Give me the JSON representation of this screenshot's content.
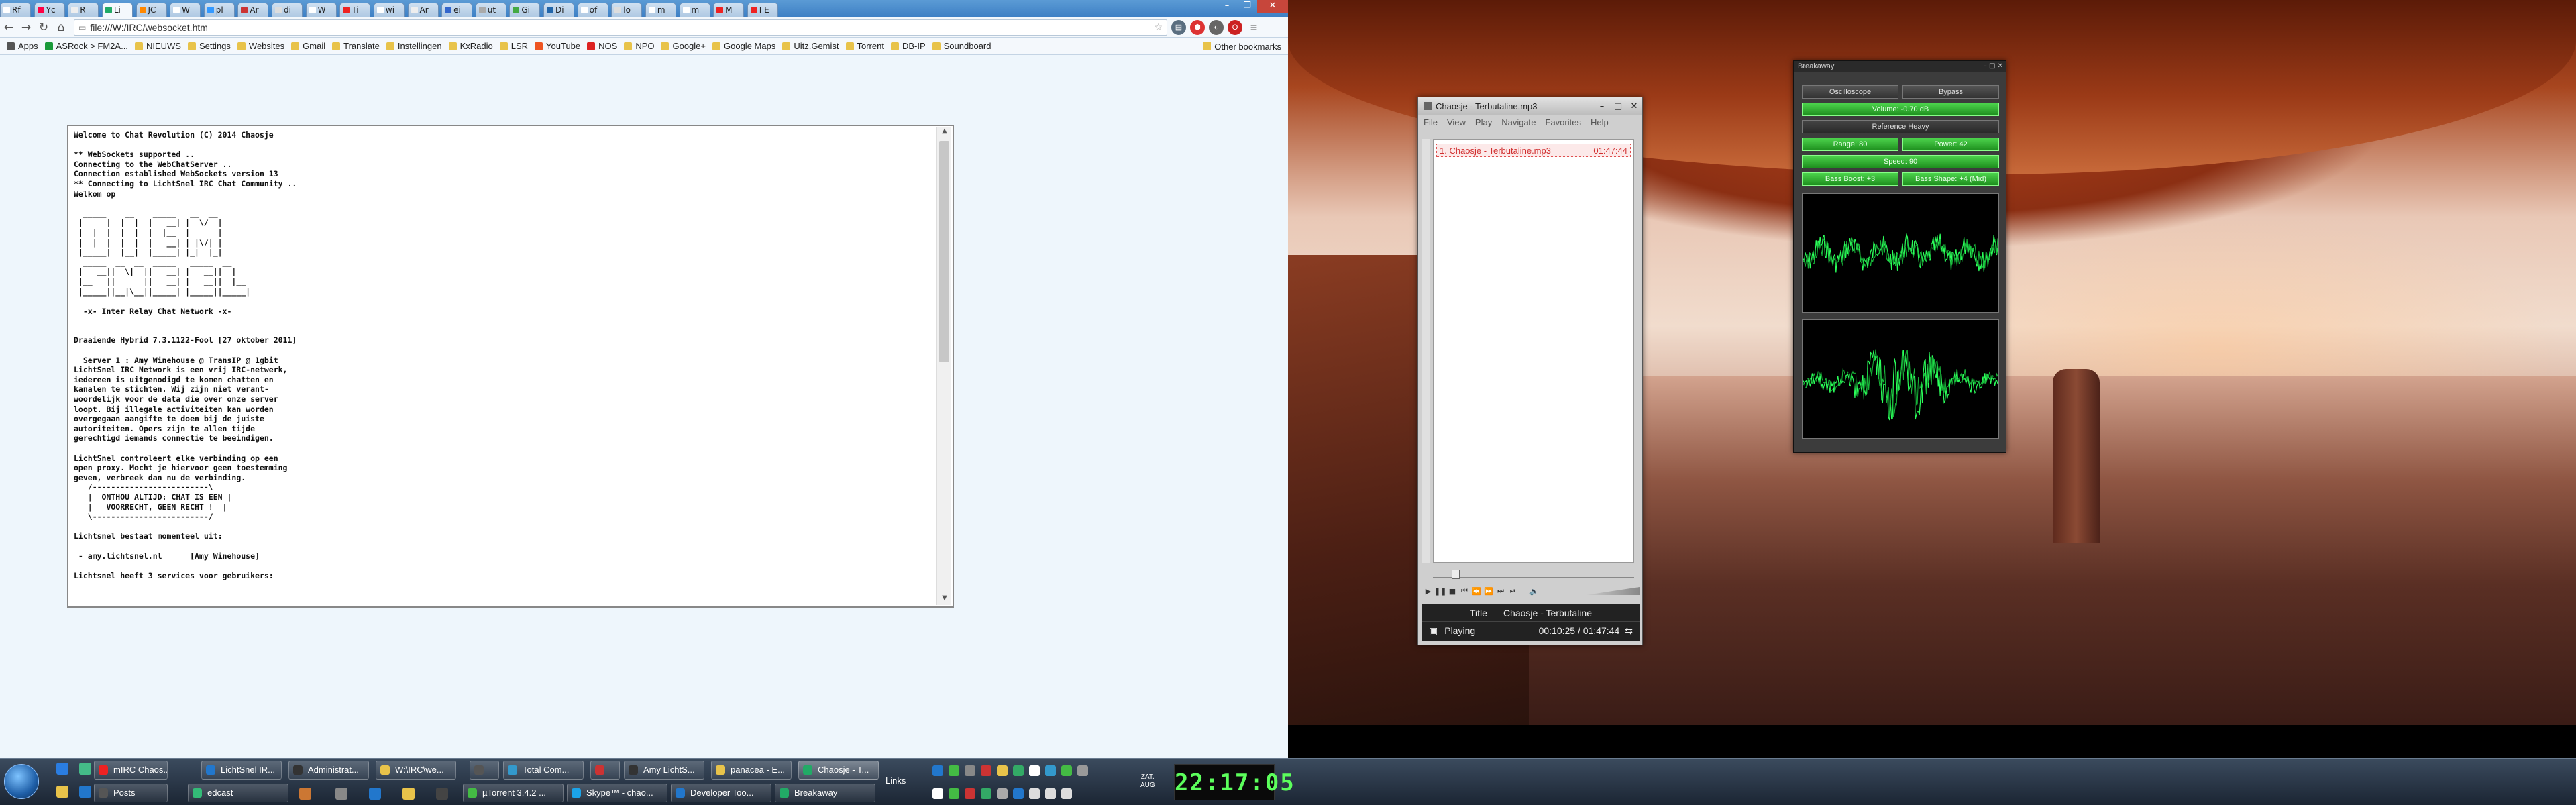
{
  "browser": {
    "tabs": [
      "Rf",
      "Yc",
      "R",
      "JC",
      "W",
      "pl",
      "Ar",
      "di",
      "W",
      "Ti",
      "wi",
      "Ar",
      "ei",
      "ut",
      "Gi",
      "Di",
      "of",
      "lo",
      "m",
      "m",
      "M",
      "I E"
    ],
    "active_tab_label": "Li",
    "url": "file:///W:/IRC/websocket.htm",
    "bookmarks": [
      "Apps",
      "ASRock > FM2A...",
      "NIEUWS",
      "Settings",
      "Websites",
      "Gmail",
      "Translate",
      "Instellingen",
      "KxRadio",
      "LSR",
      "YouTube",
      "NOS",
      "NPO",
      "Google+",
      "Google Maps",
      "Uitz.Gemist",
      "Torrent",
      "DB-IP",
      "Soundboard"
    ],
    "other_bookmarks": "Other bookmarks"
  },
  "chat": {
    "log": "Welcome to Chat Revolution (C) 2014 Chaosje\n\n** WebSockets supported ..\nConnecting to the WebChatServer ..\nConnection established WebSockets version 13\n** Connecting to LichtSnel IRC Chat Community ..\nWelkom op\n\n  _____    __    _____   __  __\n |     |  |  |  |   __| |  \\/  |\n |  |  |  |  |  |  |__  |      |\n |  |  |  |  |  |   __| | |\\/| |\n |_____|  |__|  |_____| |_|  |_|\n  _____  __  __  _____   _____  __\n |   __||  \\|  ||   __| |   __||  |\n |__   ||      ||   __| |   __||  |__\n |_____||__|\\__||_____| |_____||_____|\n\n  -x- Inter Relay Chat Network -x-\n\n\nDraaiende Hybrid 7.3.1122-Fool [27 oktober 2011]\n\n  Server 1 : Amy Winehouse @ TransIP @ 1gbit\nLichtSnel IRC Network is een vrij IRC-netwerk,\niedereen is uitgenodigd te komen chatten en\nkanalen te stichten. Wij zijn niet verant-\nwoordelijk voor de data die over onze server\nloopt. Bij illegale activiteiten kan worden\novergegaan aangifte te doen bij de juiste\nautoriteiten. Opers zijn te allen tijde\ngerechtigd iemands connectie te beeindigen.\n\nLichtSnel controleert elke verbinding op een\nopen proxy. Mocht je hiervoor geen toestemming\ngeven, verbreek dan nu de verbinding.\n   /-------------------------\\\n   |  ONTHOU ALTIJD: CHAT IS EEN |\n   |   VOORRECHT, GEEN RECHT !  |\n   \\-------------------------/\n\nLichtsnel bestaat momenteel uit:\n\n - amy.lichtsnel.nl      [Amy Winehouse]\n\nLichtsnel heeft 3 services voor gebruikers:"
  },
  "player": {
    "title": "Chaosje - Terbutaline.mp3",
    "menu": [
      "File",
      "View",
      "Play",
      "Navigate",
      "Favorites",
      "Help"
    ],
    "playlist": [
      {
        "name": "1. Chaosje - Terbutaline.mp3",
        "duration": "01:47:44"
      }
    ],
    "info_label": "Title",
    "info_value": "Chaosje - Terbutaline",
    "status": "Playing",
    "time": "00:10:25 / 01:47:44"
  },
  "breakaway": {
    "title": "Breakaway",
    "oscilloscope": "Oscilloscope",
    "bypass": "Bypass",
    "volume": "Volume: -0.70 dB",
    "preset": "Reference Heavy",
    "range": "Range: 80",
    "power": "Power: 42",
    "speed": "Speed: 90",
    "bass_boost": "Bass Boost: +3",
    "bass_shape": "Bass Shape: +4 (Mid)"
  },
  "taskbar": {
    "row1": [
      "mIRC Chaos...",
      "LichtSnel IR...",
      "Administrat...",
      "W:\\IRC\\we...",
      "",
      "Total Com...",
      "",
      "Amy LichtS...",
      "panacea - E...",
      "Chaosje - T..."
    ],
    "row2": [
      "Posts",
      "edcast",
      "",
      "",
      "",
      "µTorrent 3.4.2 ...",
      "Skype™ - chao...",
      "Developer Too...",
      "Breakaway"
    ],
    "links": "Links",
    "day": "ZAT.",
    "date": "AUG",
    "clock": "22:17:05"
  }
}
